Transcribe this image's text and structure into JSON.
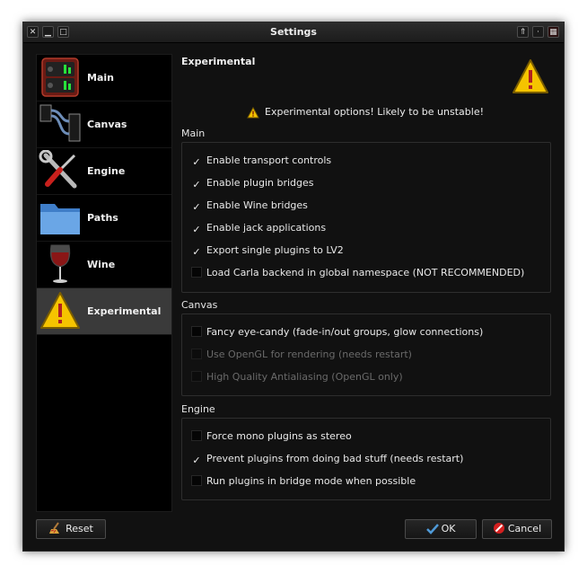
{
  "window": {
    "title": "Settings"
  },
  "sidebar": {
    "items": [
      {
        "label": "Main",
        "icon": "carla-rack-icon",
        "selected": false
      },
      {
        "label": "Canvas",
        "icon": "canvas-connections-icon",
        "selected": false
      },
      {
        "label": "Engine",
        "icon": "tools-wrench-screwdriver-icon",
        "selected": false
      },
      {
        "label": "Paths",
        "icon": "folder-icon",
        "selected": false
      },
      {
        "label": "Wine",
        "icon": "wine-glass-icon",
        "selected": false
      },
      {
        "label": "Experimental",
        "icon": "warning-icon",
        "selected": true
      }
    ]
  },
  "page": {
    "heading": "Experimental",
    "warning": "Experimental options! Likely to be unstable!",
    "groups": {
      "main": {
        "title": "Main",
        "options": [
          {
            "label": "Enable transport controls",
            "checked": true,
            "enabled": true
          },
          {
            "label": "Enable plugin bridges",
            "checked": true,
            "enabled": true
          },
          {
            "label": "Enable Wine bridges",
            "checked": true,
            "enabled": true
          },
          {
            "label": "Enable jack applications",
            "checked": true,
            "enabled": true
          },
          {
            "label": "Export single plugins to LV2",
            "checked": true,
            "enabled": true
          },
          {
            "label": "Load Carla backend in global namespace (NOT RECOMMENDED)",
            "checked": false,
            "enabled": true
          }
        ]
      },
      "canvas": {
        "title": "Canvas",
        "options": [
          {
            "label": "Fancy eye-candy (fade-in/out groups, glow connections)",
            "checked": false,
            "enabled": true
          },
          {
            "label": "Use OpenGL for rendering (needs restart)",
            "checked": false,
            "enabled": false
          },
          {
            "label": "High Quality Antialiasing (OpenGL only)",
            "checked": false,
            "enabled": false
          }
        ]
      },
      "engine": {
        "title": "Engine",
        "options": [
          {
            "label": "Force mono plugins as stereo",
            "checked": false,
            "enabled": true
          },
          {
            "label": "Prevent plugins from doing bad stuff (needs restart)",
            "checked": true,
            "enabled": true
          },
          {
            "label": "Run plugins in bridge mode when possible",
            "checked": false,
            "enabled": true
          }
        ]
      }
    }
  },
  "buttons": {
    "reset": "Reset",
    "ok": "OK",
    "cancel": "Cancel"
  },
  "check_mark": "✓",
  "colors": {
    "warning_yellow": "#f5c400",
    "background": "#111111",
    "selected_row": "#3a3a3a"
  }
}
